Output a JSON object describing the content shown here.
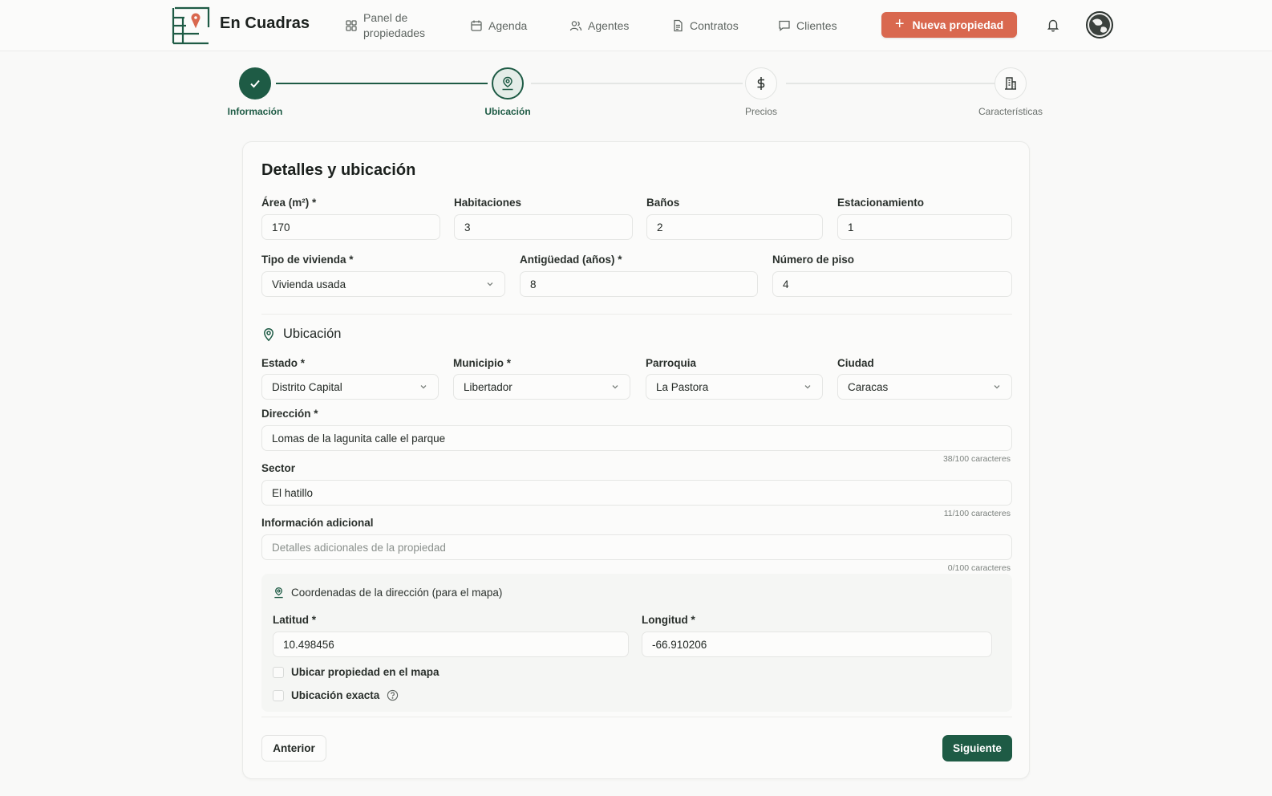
{
  "header": {
    "brand": "En Cuadras",
    "nav": [
      {
        "label": "Panel de",
        "label2": "propiedades",
        "icon": "grid-icon"
      },
      {
        "label": "Agenda",
        "icon": "calendar-icon"
      },
      {
        "label": "Agentes",
        "icon": "users-icon"
      },
      {
        "label": "Contratos",
        "icon": "document-icon"
      },
      {
        "label": "Clientes",
        "icon": "chat-icon"
      }
    ],
    "new_button": "Nueva propiedad",
    "new_button_icon": "plus-icon",
    "bell_icon": "bell-icon",
    "accent_color": "#d9684f"
  },
  "stepper": {
    "steps": [
      {
        "label": "Información",
        "state": "done",
        "icon": "check-icon"
      },
      {
        "label": "Ubicación",
        "state": "current",
        "icon": "user-pin-icon"
      },
      {
        "label": "Precios",
        "state": "todo",
        "icon": "dollar-icon"
      },
      {
        "label": "Características",
        "state": "todo",
        "icon": "building-icon"
      }
    ],
    "primary_color": "#1e5b45"
  },
  "form": {
    "title": "Detalles y ubicación",
    "area": {
      "label": "Área (m²) *",
      "value": "170"
    },
    "rooms": {
      "label": "Habitaciones",
      "value": "3"
    },
    "baths": {
      "label": "Baños",
      "value": "2"
    },
    "parking": {
      "label": "Estacionamiento",
      "value": "1"
    },
    "housing_type": {
      "label": "Tipo de vivienda *",
      "value": "Vivienda usada"
    },
    "age": {
      "label": "Antigüedad (años) *",
      "value": "8"
    },
    "floor": {
      "label": "Número de piso",
      "value": "4"
    },
    "location_section": "Ubicación",
    "state": {
      "label": "Estado *",
      "value": "Distrito Capital"
    },
    "municipality": {
      "label": "Municipio *",
      "value": "Libertador"
    },
    "parish": {
      "label": "Parroquia",
      "value": "La Pastora"
    },
    "city": {
      "label": "Ciudad",
      "value": "Caracas"
    },
    "address": {
      "label": "Dirección *",
      "value": "Lomas de la lagunita calle el parque",
      "counter": "38/100 caracteres"
    },
    "sector": {
      "label": "Sector",
      "value": "El hatillo",
      "counter": "11/100 caracteres"
    },
    "additional": {
      "label": "Información adicional",
      "placeholder": "Detalles adicionales de la propiedad",
      "counter": "0/100 caracteres"
    },
    "coords": {
      "title": "Coordenadas de la dirección (para el mapa)",
      "lat": {
        "label": "Latitud *",
        "value": "10.498456"
      },
      "lng": {
        "label": "Longitud *",
        "value": "-66.910206"
      },
      "locate_on_map": "Ubicar propiedad en el mapa",
      "exact_location": "Ubicación exacta"
    },
    "prev_button": "Anterior",
    "next_button": "Siguiente"
  }
}
